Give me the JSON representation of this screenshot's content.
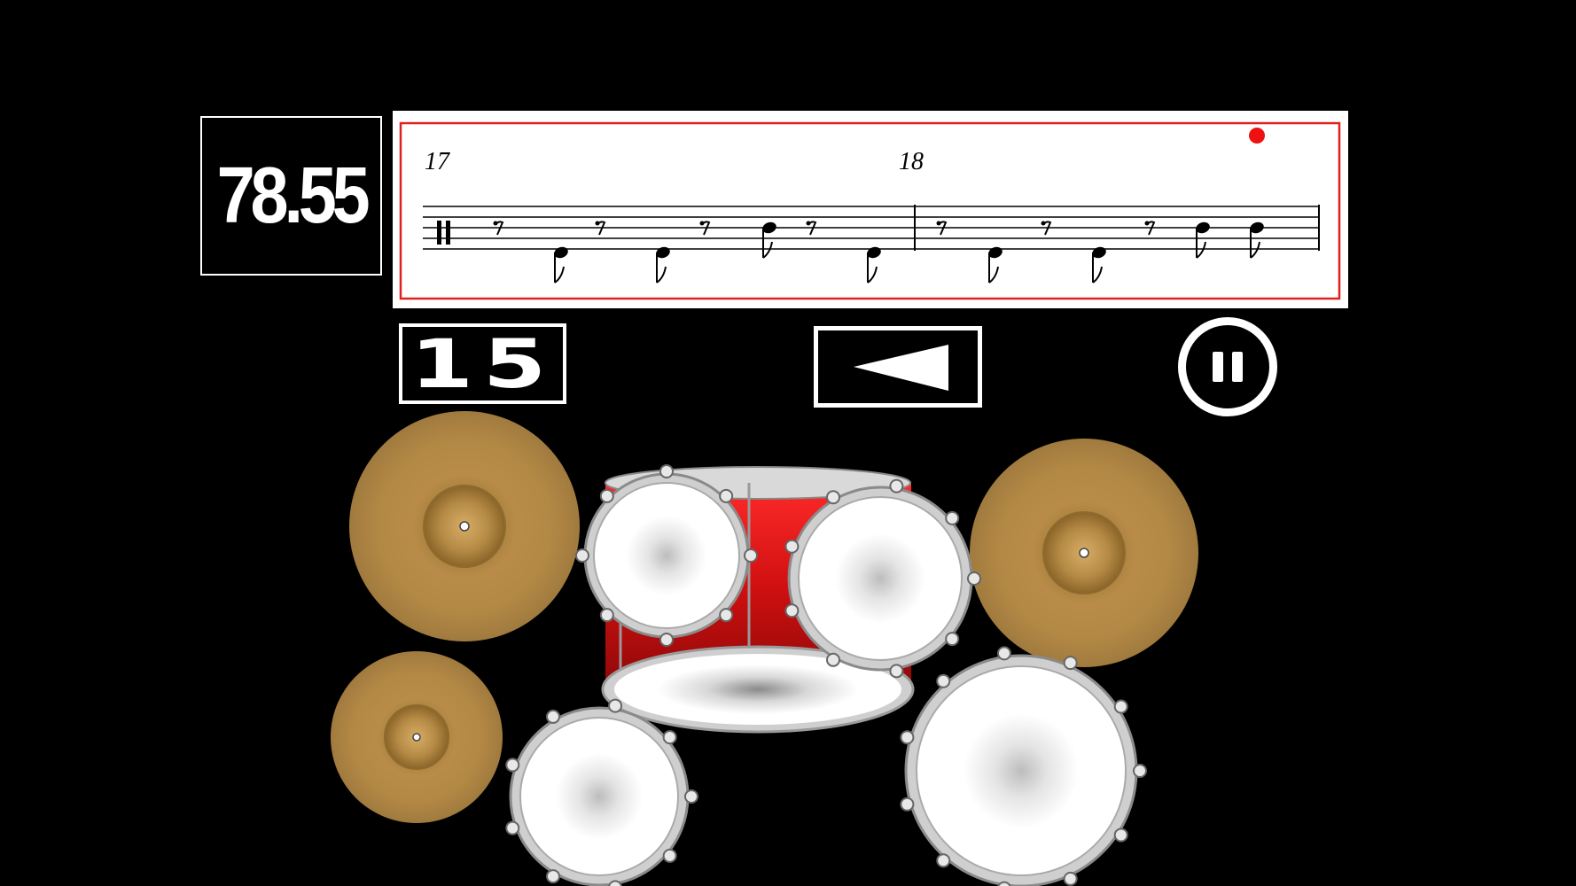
{
  "score": {
    "value": "78.55"
  },
  "staff": {
    "measure_numbers": [
      "17",
      "18"
    ],
    "border_color": "#e0201e",
    "indicator_color": "#ee1111"
  },
  "counter": {
    "value": "15"
  },
  "controls": {
    "back_icon": "left-triangle-icon",
    "pause_icon": "pause-icon"
  },
  "kit": {
    "pieces": [
      "crash-cymbal-left",
      "hi-hat-cymbal",
      "ride-cymbal-right",
      "tom-high",
      "tom-mid",
      "snare-drum",
      "floor-tom-small",
      "floor-tom-large"
    ],
    "cymbal_color": "#b08a4a",
    "shell_color": "#d41010"
  }
}
